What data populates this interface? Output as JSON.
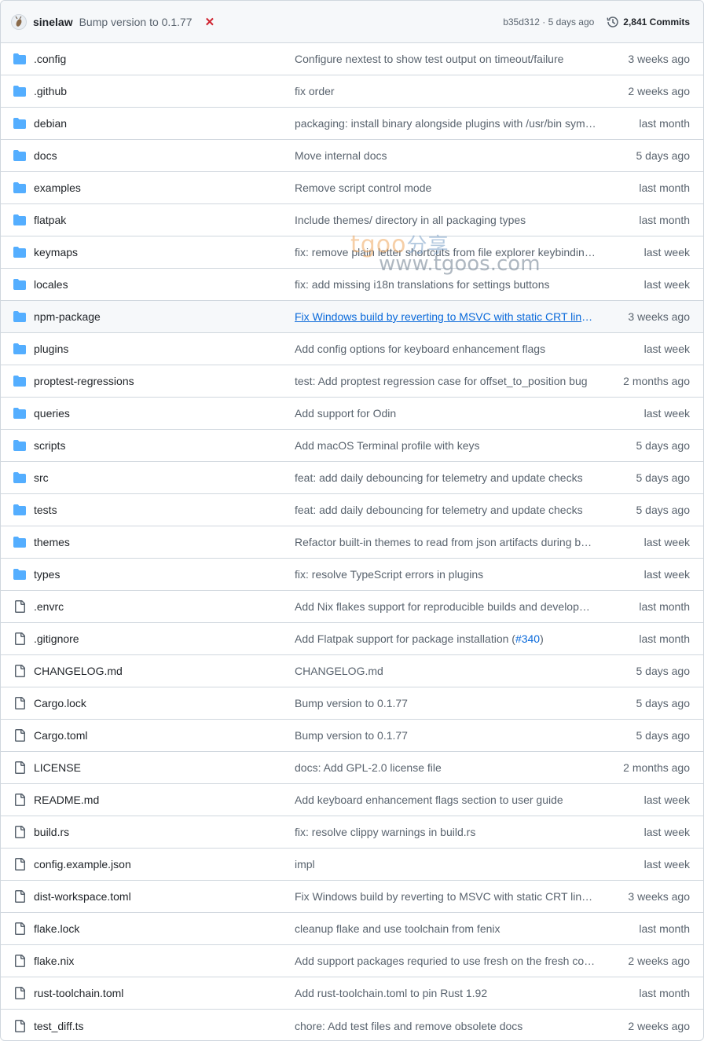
{
  "header": {
    "author": "sinelaw",
    "commit_message": "Bump version to 0.1.77",
    "status_icon": "x-icon",
    "sha_time": "b35d312 · 5 days ago",
    "commits_label": "2,841 Commits"
  },
  "watermark": {
    "brand": "tgoo",
    "chinese": "分享",
    "url": "www.tgoos.com"
  },
  "colors": {
    "folder": "#54aeff",
    "file": "#59636e",
    "link": "#0969da",
    "error": "#cf222e"
  },
  "rows": [
    {
      "type": "folder",
      "name": ".config",
      "message": "Configure nextest to show test output on timeout/failure",
      "time": "3 weeks ago"
    },
    {
      "type": "folder",
      "name": ".github",
      "message": "fix order",
      "time": "2 weeks ago"
    },
    {
      "type": "folder",
      "name": "debian",
      "message": "packaging: install binary alongside plugins with /usr/bin sym…",
      "time": "last month"
    },
    {
      "type": "folder",
      "name": "docs",
      "message": "Move internal docs",
      "time": "5 days ago"
    },
    {
      "type": "folder",
      "name": "examples",
      "message": "Remove script control mode",
      "time": "last month"
    },
    {
      "type": "folder",
      "name": "flatpak",
      "message": "Include themes/ directory in all packaging types",
      "time": "last month"
    },
    {
      "type": "folder",
      "name": "keymaps",
      "message": "fix: remove plain letter shortcuts from file explorer keybindin…",
      "time": "last week"
    },
    {
      "type": "folder",
      "name": "locales",
      "message": "fix: add missing i18n translations for settings buttons",
      "time": "last week"
    },
    {
      "type": "folder",
      "name": "npm-package",
      "message": "Fix Windows build by reverting to MSVC with static CRT linki…",
      "time": "3 weeks ago",
      "hover": true
    },
    {
      "type": "folder",
      "name": "plugins",
      "message": "Add config options for keyboard enhancement flags",
      "time": "last week"
    },
    {
      "type": "folder",
      "name": "proptest-regressions",
      "message": "test: Add proptest regression case for offset_to_position bug",
      "time": "2 months ago"
    },
    {
      "type": "folder",
      "name": "queries",
      "message": "Add support for Odin",
      "time": "last week"
    },
    {
      "type": "folder",
      "name": "scripts",
      "message": "Add macOS Terminal profile with keys",
      "time": "5 days ago"
    },
    {
      "type": "folder",
      "name": "src",
      "message": "feat: add daily debouncing for telemetry and update checks",
      "time": "5 days ago"
    },
    {
      "type": "folder",
      "name": "tests",
      "message": "feat: add daily debouncing for telemetry and update checks",
      "time": "5 days ago"
    },
    {
      "type": "folder",
      "name": "themes",
      "message": "Refactor built-in themes to read from json artifacts during b…",
      "time": "last week"
    },
    {
      "type": "folder",
      "name": "types",
      "message": "fix: resolve TypeScript errors in plugins",
      "time": "last week"
    },
    {
      "type": "file",
      "name": ".envrc",
      "message": "Add Nix flakes support for reproducible builds and develop…",
      "time": "last month"
    },
    {
      "type": "file",
      "name": ".gitignore",
      "message": "Add Flatpak support for package installation (",
      "pr": "#340",
      "message_suffix": ")",
      "time": "last month"
    },
    {
      "type": "file",
      "name": "CHANGELOG.md",
      "message": "CHANGELOG.md",
      "time": "5 days ago"
    },
    {
      "type": "file",
      "name": "Cargo.lock",
      "message": "Bump version to 0.1.77",
      "time": "5 days ago"
    },
    {
      "type": "file",
      "name": "Cargo.toml",
      "message": "Bump version to 0.1.77",
      "time": "5 days ago"
    },
    {
      "type": "file",
      "name": "LICENSE",
      "message": "docs: Add GPL-2.0 license file",
      "time": "2 months ago"
    },
    {
      "type": "file",
      "name": "README.md",
      "message": "Add keyboard enhancement flags section to user guide",
      "time": "last week"
    },
    {
      "type": "file",
      "name": "build.rs",
      "message": "fix: resolve clippy warnings in build.rs",
      "time": "last week"
    },
    {
      "type": "file",
      "name": "config.example.json",
      "message": "impl",
      "time": "last week"
    },
    {
      "type": "file",
      "name": "dist-workspace.toml",
      "message": "Fix Windows build by reverting to MSVC with static CRT linki…",
      "time": "3 weeks ago"
    },
    {
      "type": "file",
      "name": "flake.lock",
      "message": "cleanup flake and use toolchain from fenix",
      "time": "last month"
    },
    {
      "type": "file",
      "name": "flake.nix",
      "message": "Add support packages requried to use fresh on the fresh co…",
      "time": "2 weeks ago"
    },
    {
      "type": "file",
      "name": "rust-toolchain.toml",
      "message": "Add rust-toolchain.toml to pin Rust 1.92",
      "time": "last month"
    },
    {
      "type": "file",
      "name": "test_diff.ts",
      "message": "chore: Add test files and remove obsolete docs",
      "time": "2 weeks ago"
    }
  ]
}
